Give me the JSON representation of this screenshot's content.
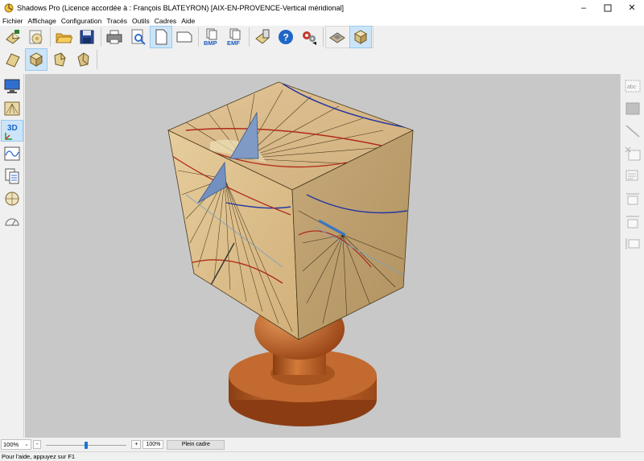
{
  "window": {
    "title": "Shadows Pro  (Licence accordée à :  François BLATEYRON) [AIX-EN-PROVENCE-Vertical méridional]",
    "minimize_icon": "minimize-icon",
    "maximize_icon": "maximize-icon",
    "close_icon": "close-icon"
  },
  "menu": {
    "items": [
      {
        "label": "Fichier"
      },
      {
        "label": "Affichage"
      },
      {
        "label": "Configuration"
      },
      {
        "label": "Tracés"
      },
      {
        "label": "Outils"
      },
      {
        "label": "Cadres"
      },
      {
        "label": "Aide"
      }
    ]
  },
  "toolbar": {
    "bmp_label": "BMP",
    "emf_label": "EMF",
    "help_label": "?"
  },
  "leftbar": {
    "three_d_label": "3D"
  },
  "rightbar": {
    "abc_label": "abc"
  },
  "zoom": {
    "selected": "100%",
    "minus_label": "-",
    "plus_label": "+",
    "value_label": "100%",
    "level": 0.5,
    "full_frame_label": "Plein cadre"
  },
  "status": {
    "help_text": "Pour l'aide, appuyez sur F1"
  },
  "colors": {
    "accent_active": "#cce4f7",
    "cube_face": "#d4b584",
    "stand": "#c2652a",
    "background": "#c8c8c8"
  }
}
